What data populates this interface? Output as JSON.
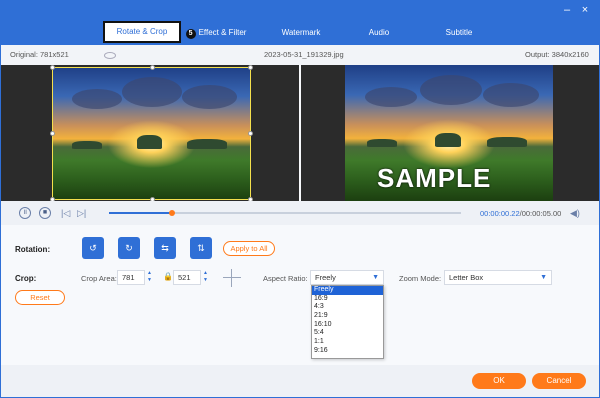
{
  "tabs": [
    {
      "label": "Rotate & Crop",
      "active": true
    },
    {
      "label": "Effect & Filter",
      "badge": "5"
    },
    {
      "label": "Watermark"
    },
    {
      "label": "Audio"
    },
    {
      "label": "Subtitle"
    }
  ],
  "window": {
    "minimize_glyph": "–",
    "close_glyph": "×"
  },
  "info": {
    "original": "Original: 781x521",
    "filename": "2023-05-31_191329.jpg",
    "output": "Output: 3840x2160"
  },
  "preview": {
    "watermark_text": "SAMPLE"
  },
  "player": {
    "current_time": "00:00:00.22",
    "total_time": "/00:00:05.00",
    "progress": 0.18
  },
  "rotation": {
    "label": "Rotation:",
    "apply_all": "Apply to All"
  },
  "crop": {
    "label": "Crop:",
    "area_label": "Crop Area:",
    "width": "781",
    "height": "521",
    "reset": "Reset"
  },
  "aspect": {
    "label": "Aspect Ratio:",
    "selected": "Freely",
    "options": [
      "Freely",
      "16:9",
      "4:3",
      "21:9",
      "16:10",
      "5:4",
      "1:1",
      "9:16"
    ]
  },
  "zoom": {
    "label": "Zoom Mode:",
    "selected": "Letter Box"
  },
  "footer": {
    "ok": "OK",
    "cancel": "Cancel"
  },
  "colors": {
    "accent": "#2f6fd6",
    "action": "#ff7a1a",
    "crop_frame": "#f4e04d"
  }
}
